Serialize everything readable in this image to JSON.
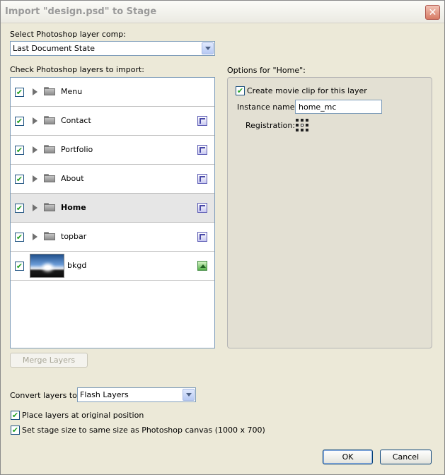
{
  "dialog": {
    "title": "Import \"design.psd\" to Stage",
    "close_glyph": "✕"
  },
  "layer_comp": {
    "label": "Select Photoshop layer comp:",
    "selected": "Last Document State"
  },
  "layers_section": {
    "label": "Check Photoshop layers to import:",
    "rows": [
      {
        "name": "Menu",
        "checked": true,
        "kind": "folder",
        "type_icon": "none"
      },
      {
        "name": "Contact",
        "checked": true,
        "kind": "folder",
        "type_icon": "movie-clip-icon"
      },
      {
        "name": "Portfolio",
        "checked": true,
        "kind": "folder",
        "type_icon": "movie-clip-icon"
      },
      {
        "name": "About",
        "checked": true,
        "kind": "folder",
        "type_icon": "movie-clip-icon"
      },
      {
        "name": "Home",
        "checked": true,
        "kind": "folder",
        "type_icon": "movie-clip-icon",
        "selected": true
      },
      {
        "name": "topbar",
        "checked": true,
        "kind": "folder",
        "type_icon": "movie-clip-icon"
      },
      {
        "name": "bkgd",
        "checked": true,
        "kind": "image",
        "type_icon": "bitmap-icon"
      }
    ]
  },
  "options": {
    "label": "Options for \"Home\":",
    "create_movie_clip_label": "Create movie clip for this layer",
    "create_movie_clip_checked": true,
    "instance_name_label": "Instance name:",
    "instance_name_value": "home_mc",
    "registration_label": "Registration:"
  },
  "merge_button_label": "Merge Layers",
  "convert": {
    "label": "Convert layers to:",
    "selected": "Flash Layers"
  },
  "place_original_label": "Place layers at original position",
  "place_original_checked": true,
  "stage_size_label": "Set stage size to same size as Photoshop canvas (1000 x 700)",
  "stage_size_checked": true,
  "buttons": {
    "ok": "OK",
    "cancel": "Cancel"
  },
  "tick_glyph": "✔",
  "colors": {
    "check_tick": "#21a121",
    "window_bg": "#ece9d8",
    "selected_row": "#e6e6e6"
  }
}
